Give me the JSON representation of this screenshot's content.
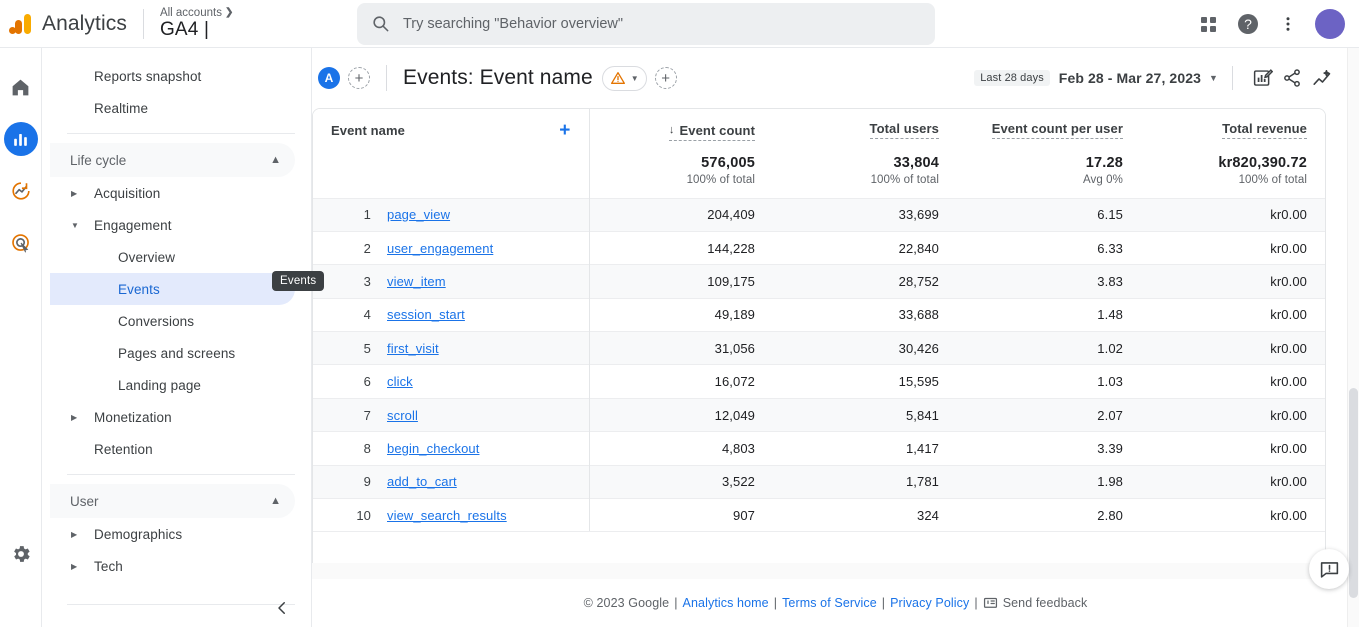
{
  "topbar": {
    "brand": "Analytics",
    "account_breadcrumb": "All accounts",
    "property_name": "GA4 |",
    "search_placeholder": "Try searching \"Behavior overview\"",
    "search_value": "",
    "icons": {
      "search": "search-icon",
      "apps": "apps-grid-icon",
      "help": "help-icon",
      "more": "more-vertical-icon",
      "avatar": "user-avatar"
    }
  },
  "rail": {
    "items": [
      {
        "name": "home-icon",
        "label": "Home",
        "active": false
      },
      {
        "name": "reports-icon",
        "label": "Reports",
        "active": true
      },
      {
        "name": "explore-icon",
        "label": "Explore",
        "active": false
      },
      {
        "name": "advertising-icon",
        "label": "Advertising",
        "active": false
      }
    ],
    "settings": {
      "name": "gear-icon",
      "label": "Admin"
    }
  },
  "sidebar": {
    "top_items": [
      {
        "label": "Reports snapshot",
        "selected": false
      },
      {
        "label": "Realtime",
        "selected": false
      }
    ],
    "sections": [
      {
        "label": "Life cycle",
        "expanded": true,
        "items": [
          {
            "label": "Acquisition",
            "expandable": true,
            "expanded": false,
            "selected": false,
            "sub": false
          },
          {
            "label": "Engagement",
            "expandable": true,
            "expanded": true,
            "selected": false,
            "sub": false
          },
          {
            "label": "Overview",
            "expandable": false,
            "selected": false,
            "sub": true
          },
          {
            "label": "Events",
            "expandable": false,
            "selected": true,
            "sub": true
          },
          {
            "label": "Conversions",
            "expandable": false,
            "selected": false,
            "sub": true
          },
          {
            "label": "Pages and screens",
            "expandable": false,
            "selected": false,
            "sub": true
          },
          {
            "label": "Landing page",
            "expandable": false,
            "selected": false,
            "sub": true
          },
          {
            "label": "Monetization",
            "expandable": true,
            "expanded": false,
            "selected": false,
            "sub": false
          },
          {
            "label": "Retention",
            "expandable": false,
            "selected": false,
            "sub": false
          }
        ]
      },
      {
        "label": "User",
        "expanded": true,
        "items": [
          {
            "label": "Demographics",
            "expandable": true,
            "expanded": false,
            "selected": false,
            "sub": false
          },
          {
            "label": "Tech",
            "expandable": true,
            "expanded": false,
            "selected": false,
            "sub": false
          }
        ]
      }
    ],
    "tooltip": "Events",
    "collapse_label": "Collapse navigation"
  },
  "report": {
    "audience_badge": "A",
    "add_comparison_label": "+",
    "title": "Events: Event name",
    "warning_chip_label": "",
    "add_secondary_label": "+",
    "date_pill": "Last 28 days",
    "date_range": "Feb 28 - Mar 27, 2023",
    "actions": [
      {
        "name": "edit-chart-icon",
        "label": "Customize report"
      },
      {
        "name": "share-icon",
        "label": "Share this report"
      },
      {
        "name": "insights-icon",
        "label": "Insights"
      }
    ]
  },
  "table": {
    "dimension_header": "Event name",
    "metric_headers": [
      {
        "label": "Event count",
        "sorted": true,
        "sort_dir": "desc"
      },
      {
        "label": "Total users",
        "sorted": false
      },
      {
        "label": "Event count per user",
        "sorted": false
      },
      {
        "label": "Total revenue",
        "sorted": false
      }
    ],
    "totals": [
      {
        "value": "576,005",
        "sub": "100% of total"
      },
      {
        "value": "33,804",
        "sub": "100% of total"
      },
      {
        "value": "17.28",
        "sub": "Avg 0%"
      },
      {
        "value": "kr820,390.72",
        "sub": "100% of total"
      }
    ],
    "rows": [
      {
        "rank": "1",
        "name": "page_view",
        "event_count": "204,409",
        "total_users": "33,699",
        "per_user": "6.15",
        "revenue": "kr0.00"
      },
      {
        "rank": "2",
        "name": "user_engagement",
        "event_count": "144,228",
        "total_users": "22,840",
        "per_user": "6.33",
        "revenue": "kr0.00"
      },
      {
        "rank": "3",
        "name": "view_item",
        "event_count": "109,175",
        "total_users": "28,752",
        "per_user": "3.83",
        "revenue": "kr0.00"
      },
      {
        "rank": "4",
        "name": "session_start",
        "event_count": "49,189",
        "total_users": "33,688",
        "per_user": "1.48",
        "revenue": "kr0.00"
      },
      {
        "rank": "5",
        "name": "first_visit",
        "event_count": "31,056",
        "total_users": "30,426",
        "per_user": "1.02",
        "revenue": "kr0.00"
      },
      {
        "rank": "6",
        "name": "click",
        "event_count": "16,072",
        "total_users": "15,595",
        "per_user": "1.03",
        "revenue": "kr0.00"
      },
      {
        "rank": "7",
        "name": "scroll",
        "event_count": "12,049",
        "total_users": "5,841",
        "per_user": "2.07",
        "revenue": "kr0.00"
      },
      {
        "rank": "8",
        "name": "begin_checkout",
        "event_count": "4,803",
        "total_users": "1,417",
        "per_user": "3.39",
        "revenue": "kr0.00"
      },
      {
        "rank": "9",
        "name": "add_to_cart",
        "event_count": "3,522",
        "total_users": "1,781",
        "per_user": "1.98",
        "revenue": "kr0.00"
      },
      {
        "rank": "10",
        "name": "view_search_results",
        "event_count": "907",
        "total_users": "324",
        "per_user": "2.80",
        "revenue": "kr0.00"
      }
    ]
  },
  "footer": {
    "copyright": "© 2023 Google",
    "links": [
      "Analytics home",
      "Terms of Service",
      "Privacy Policy"
    ],
    "feedback": "Send feedback"
  },
  "fab": {
    "name": "feedback-icon",
    "label": "Send feedback"
  },
  "colors": {
    "accent_blue": "#1a73e8",
    "link_blue": "#1967d2",
    "selected_bg": "#e3eafc",
    "warning_orange": "#e37400",
    "avatar_purple": "#6c63c4"
  }
}
